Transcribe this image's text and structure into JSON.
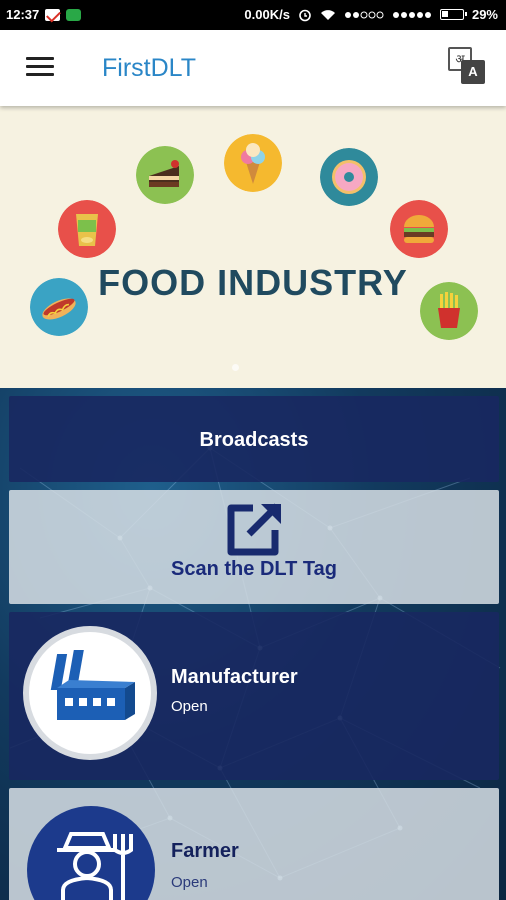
{
  "status_bar": {
    "time": "12:37",
    "network_speed": "0.00K/s",
    "battery": "29%",
    "icons": [
      "gmail-icon",
      "app-notification-icon",
      "alarm-icon",
      "wifi-icon",
      "signal-icon",
      "signal-icon",
      "battery-icon"
    ]
  },
  "app_bar": {
    "title": "FirstDLT",
    "menu_icon": "hamburger-menu-icon",
    "translate_icon": "translate-icon",
    "translate_back": "अ",
    "translate_front": "A"
  },
  "banner": {
    "title": "FOOD INDUSTRY",
    "items": [
      "hotdog-icon",
      "chips-icon",
      "cake-icon",
      "ice-cream-icon",
      "donut-icon",
      "burger-icon",
      "fries-icon"
    ],
    "colors": {
      "background": "#f6f2e1",
      "title": "#204a5f"
    }
  },
  "menu": {
    "broadcasts": {
      "label": "Broadcasts"
    },
    "scan": {
      "label": "Scan the DLT Tag",
      "icon": "open-external-icon"
    },
    "roles": [
      {
        "title": "Manufacturer",
        "status": "Open",
        "icon": "factory-icon"
      },
      {
        "title": "Farmer",
        "status": "Open",
        "icon": "farmer-icon"
      }
    ]
  },
  "colors": {
    "accent": "#2a86c7",
    "card_dark": "#182860",
    "card_light": "#d6dee4",
    "icon_blue": "#1c5fb5"
  }
}
